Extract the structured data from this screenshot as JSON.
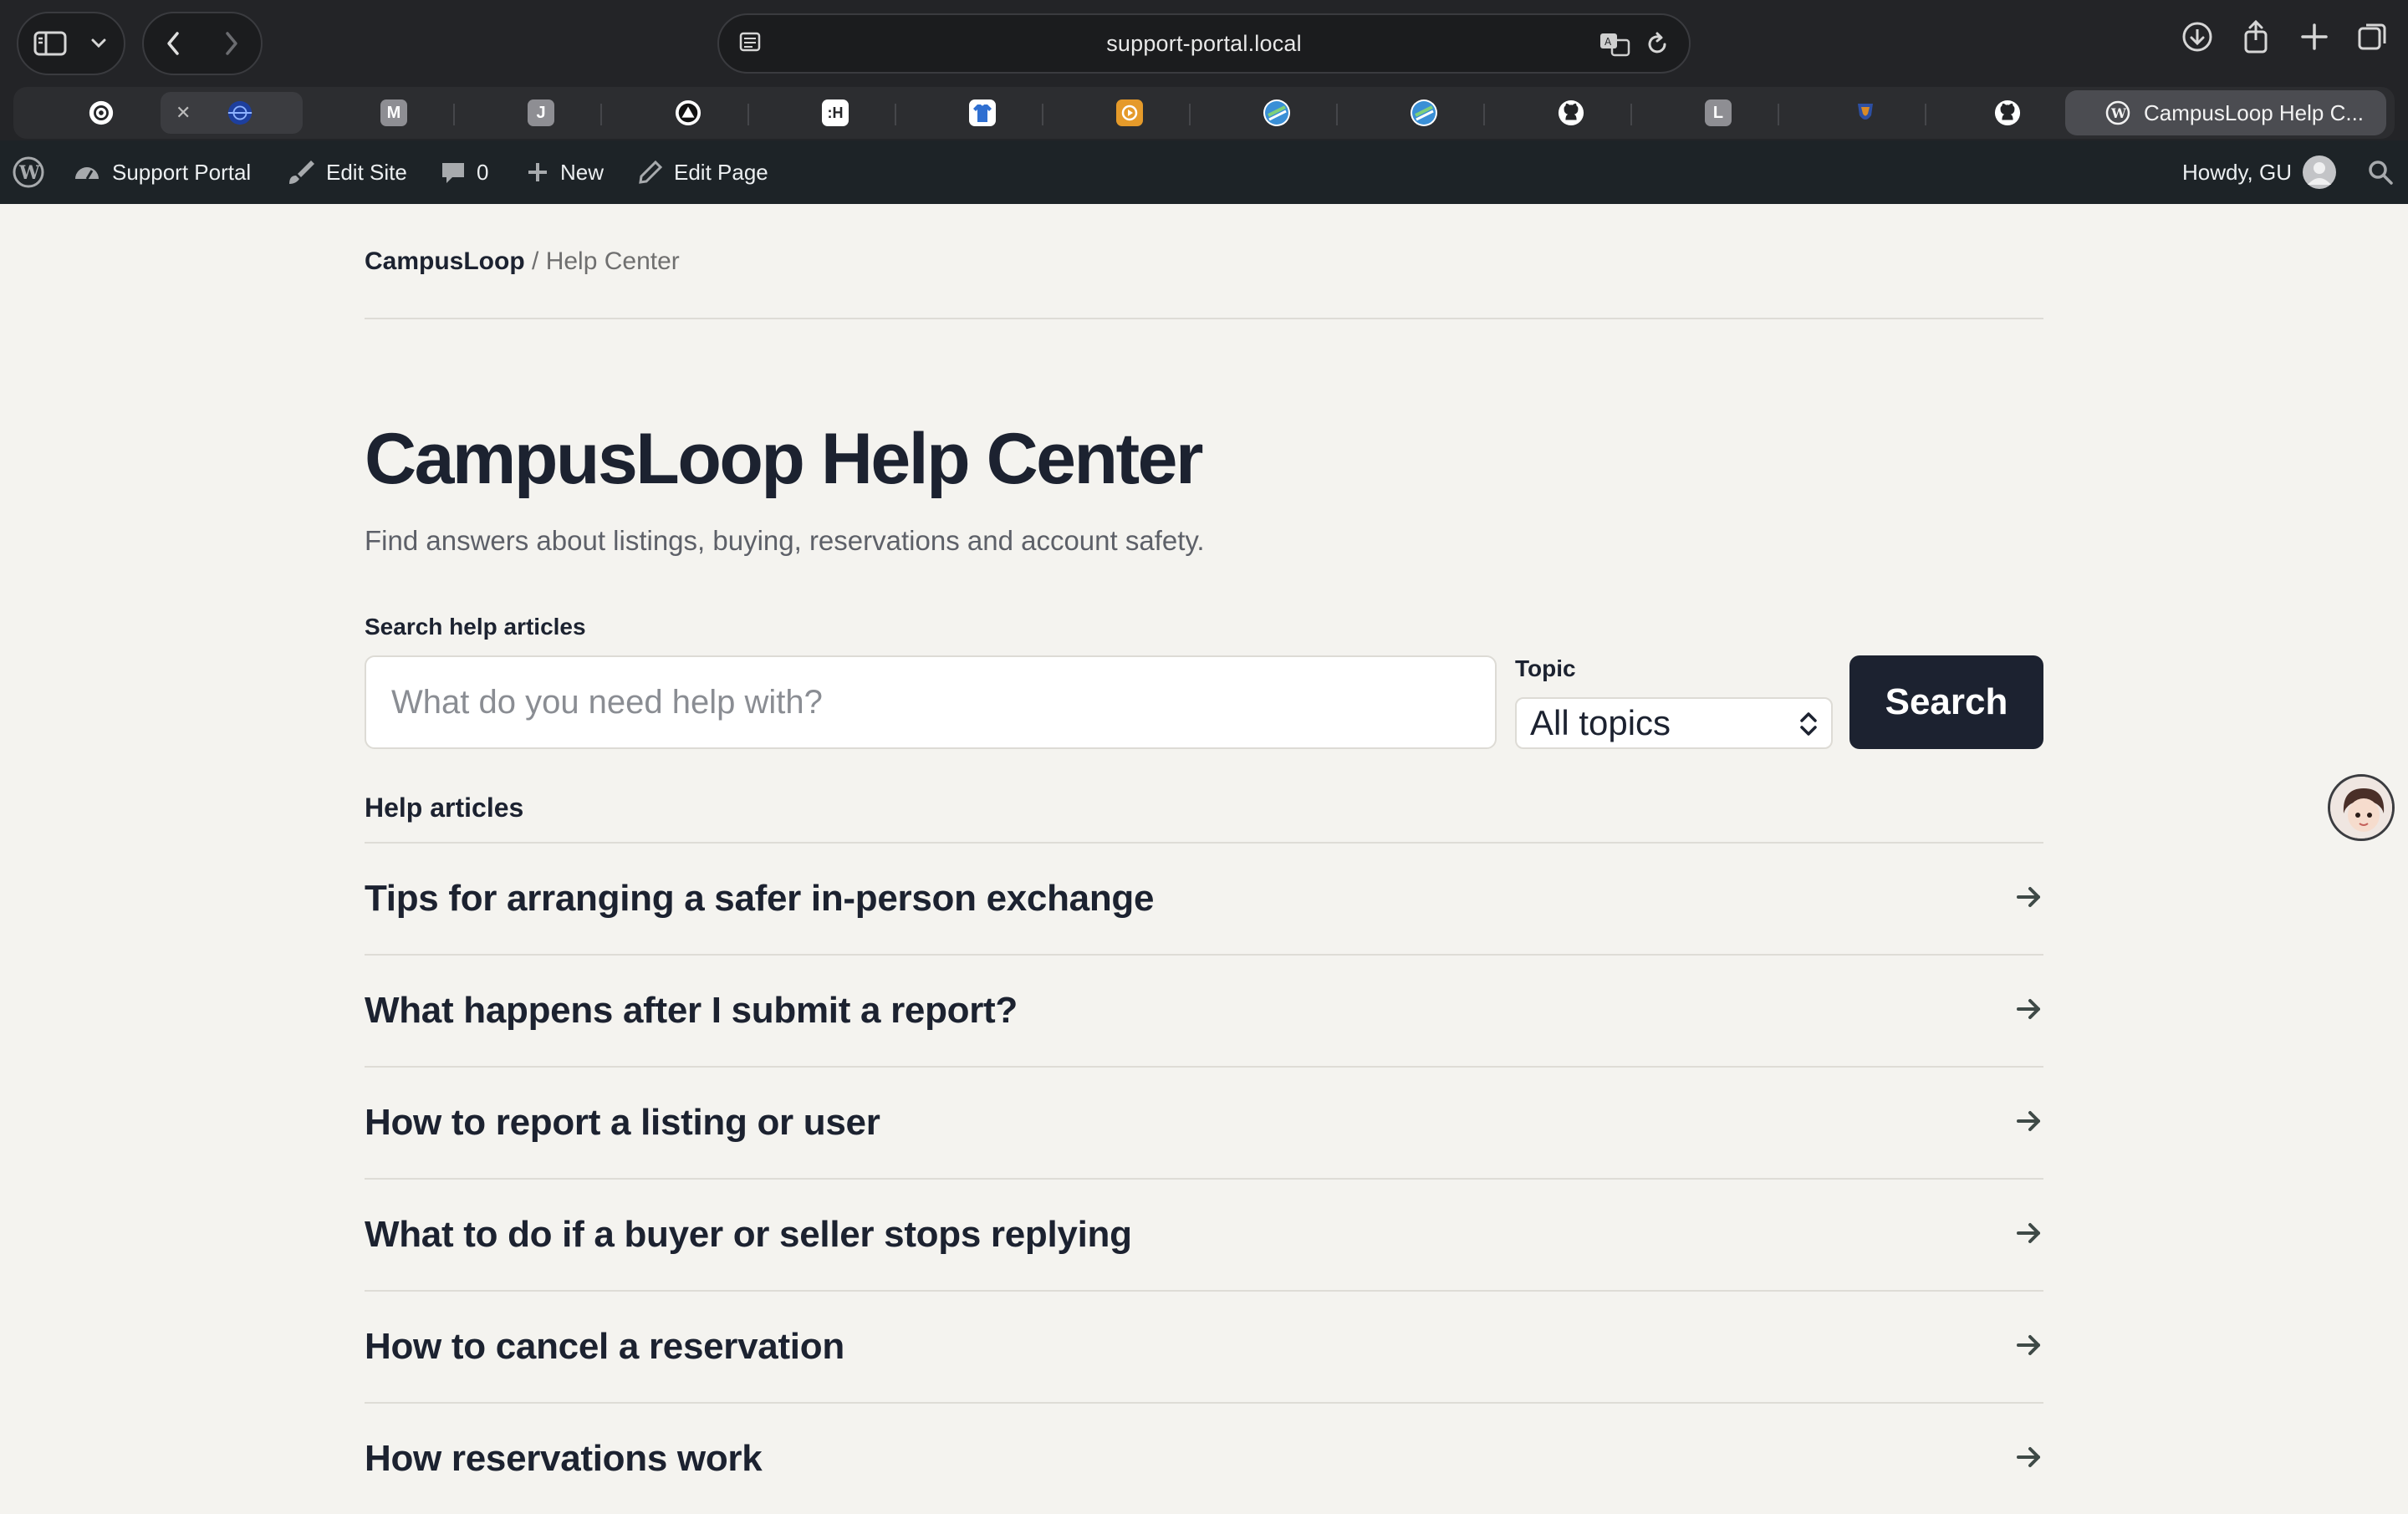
{
  "browser": {
    "url": "support-portal.local",
    "active_tab_title": "CampusLoop Help C...",
    "tabs": [
      {
        "icon": "openai-icon",
        "color": "#ffffff"
      },
      {
        "icon": "globe-icon",
        "color": "#1d3f9e"
      },
      {
        "icon": "m-icon",
        "letter": "M",
        "color": "#8e8e93"
      },
      {
        "icon": "j-icon",
        "letter": "J",
        "color": "#8e8e93"
      },
      {
        "icon": "triangle-icon",
        "color": "#ffffff"
      },
      {
        "icon": "h-icon",
        "letter": ":H",
        "color": "#ffffff"
      },
      {
        "icon": "shirt-icon",
        "color": "#ffffff"
      },
      {
        "icon": "orange-icon",
        "color": "#e59a2a"
      },
      {
        "icon": "stripes-icon",
        "color": "#3a8fd6"
      },
      {
        "icon": "stripes-icon",
        "color": "#3a8fd6"
      },
      {
        "icon": "github-icon",
        "color": "#ffffff"
      },
      {
        "icon": "l-icon",
        "letter": "L",
        "color": "#8e8e93"
      },
      {
        "icon": "crest-icon",
        "color": "#d98a26"
      },
      {
        "icon": "github-icon",
        "color": "#ffffff"
      }
    ]
  },
  "adminbar": {
    "site_name": "Support Portal",
    "edit_site": "Edit Site",
    "comments_count": "0",
    "new_label": "New",
    "edit_page": "Edit Page",
    "howdy": "Howdy, GU"
  },
  "page": {
    "breadcrumb_brand": "CampusLoop",
    "breadcrumb_sep": " / ",
    "breadcrumb_current": "Help Center",
    "title": "CampusLoop Help Center",
    "subtitle": "Find answers about listings, buying, reservations and account safety.",
    "search_label": "Search help articles",
    "search_placeholder": "What do you need help with?",
    "topic_label": "Topic",
    "topic_value": "All topics",
    "search_button": "Search",
    "articles_heading": "Help articles",
    "articles": [
      "Tips for arranging a safer in-person exchange",
      "What happens after I submit a report?",
      "How to report a listing or user",
      "What to do if a buyer or seller stops replying",
      "How to cancel a reservation",
      "How reservations work"
    ]
  }
}
